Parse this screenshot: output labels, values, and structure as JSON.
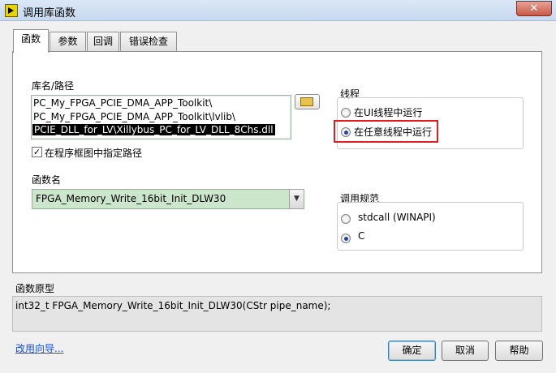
{
  "window": {
    "title": "调用库函数",
    "close_glyph": "✕"
  },
  "tabs": [
    {
      "label": "函数",
      "active": true
    },
    {
      "label": "参数"
    },
    {
      "label": "回调"
    },
    {
      "label": "错误检查"
    }
  ],
  "library": {
    "label": "库名/路径",
    "path_lines": [
      "PC_My_FPGA_PCIE_DMA_APP_Toolkit\\",
      "PC_My_FPGA_PCIE_DMA_APP_Toolkit\\lvlib\\",
      "PCIE_DLL_for_LV\\Xillybus_PC_for_LV_DLL_8Chs.dll"
    ],
    "specify_path_label": "在程序框图中指定路径",
    "specify_path_checked": true
  },
  "function_name": {
    "label": "函数名",
    "value": "FPGA_Memory_Write_16bit_Init_DLW30"
  },
  "thread": {
    "title": "线程",
    "options": [
      "在UI线程中运行",
      "在任意线程中运行"
    ],
    "selected": 1
  },
  "calling_convention": {
    "title": "调用规范",
    "options": [
      "stdcall (WINAPI)",
      "C"
    ],
    "selected": 1
  },
  "prototype": {
    "label": "函数原型",
    "value": "int32_t FPGA_Memory_Write_16bit_Init_DLW30(CStr pipe_name);"
  },
  "footer": {
    "wizard_link": "改用向导...",
    "ok": "确定",
    "cancel": "取消",
    "help": "帮助"
  },
  "colors": {
    "highlight": "#e02020",
    "link": "#1a4fd6",
    "combo_bg": "#cce6cc"
  }
}
